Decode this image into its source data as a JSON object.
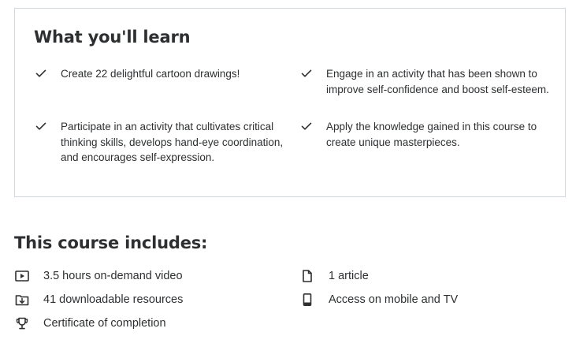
{
  "learn": {
    "title": "What you'll learn",
    "items": [
      {
        "text": "Create 22 delightful cartoon drawings!",
        "icon": "check-icon"
      },
      {
        "text": "Engage in an activity that has been shown to improve self-confidence and boost self-esteem.",
        "icon": "check-icon"
      },
      {
        "text": "Participate in an activity that cultivates critical thinking skills, develops hand-eye coordination, and encourages self-expression.",
        "icon": "check-icon"
      },
      {
        "text": "Apply the knowledge gained in this course to create unique masterpieces.",
        "icon": "check-icon"
      }
    ]
  },
  "includes": {
    "title": "This course includes:",
    "items": [
      {
        "label": "3.5 hours on-demand video",
        "icon": "video-icon"
      },
      {
        "label": "1 article",
        "icon": "file-icon"
      },
      {
        "label": "41 downloadable resources",
        "icon": "download-icon"
      },
      {
        "label": "Access on mobile and TV",
        "icon": "mobile-icon"
      },
      {
        "label": "Certificate of completion",
        "icon": "trophy-icon"
      }
    ]
  }
}
